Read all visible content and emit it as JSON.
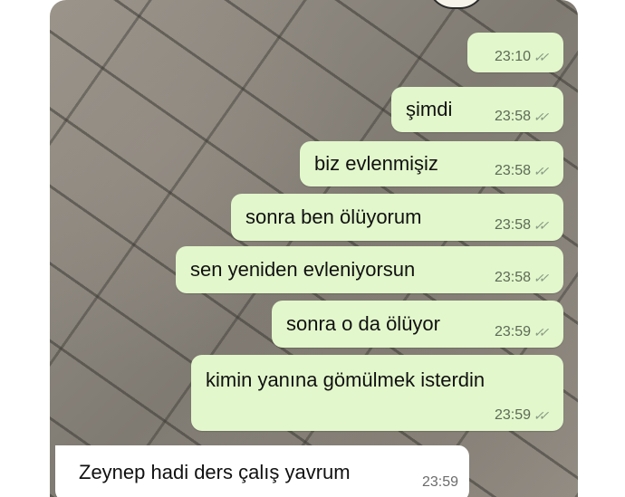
{
  "messages": [
    {
      "text": "",
      "time": "23:10",
      "status": "read"
    },
    {
      "text": "şimdi",
      "time": "23:58",
      "status": "read"
    },
    {
      "text": "biz evlenmişiz",
      "time": "23:58",
      "status": "read"
    },
    {
      "text": "sonra ben ölüyorum",
      "time": "23:58",
      "status": "read"
    },
    {
      "text": "sen yeniden evleniyorsun",
      "time": "23:58",
      "status": "read"
    },
    {
      "text": "sonra o da ölüyor",
      "time": "23:59",
      "status": "read"
    },
    {
      "text": "kimin yanına gömülmek isterdin",
      "time": "23:59",
      "status": "read"
    }
  ],
  "reply": {
    "text": "Zeynep hadi ders çalış yavrum",
    "time": "23:59"
  },
  "icons": {
    "read_receipt": "double-check-icon"
  },
  "colors": {
    "outgoing_bubble": "#e2f7cb",
    "incoming_bubble": "#ffffff",
    "wallpaper": "#8a857c"
  }
}
